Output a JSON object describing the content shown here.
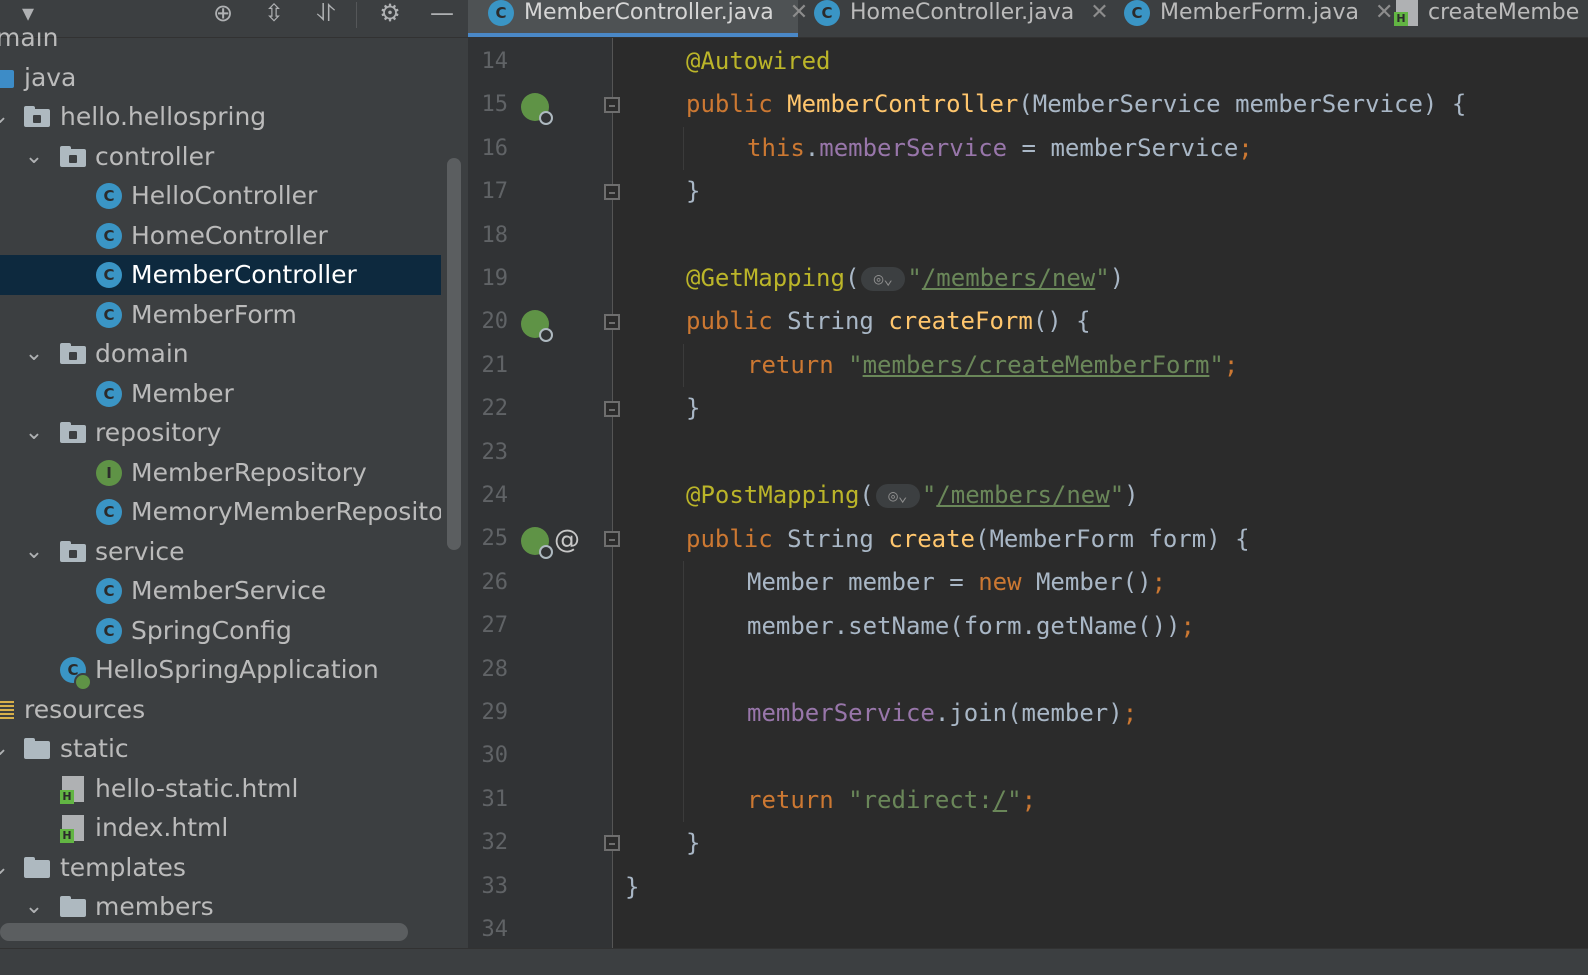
{
  "project_tree": {
    "items": [
      {
        "label": "main",
        "icon": "folder-icon",
        "row": -1
      },
      {
        "label": "java",
        "icon": "source-folder-icon"
      },
      {
        "label": "hello.hellospring",
        "icon": "package-icon"
      },
      {
        "label": "controller",
        "icon": "package-icon"
      },
      {
        "label": "HelloController",
        "icon": "class-icon"
      },
      {
        "label": "HomeController",
        "icon": "class-icon"
      },
      {
        "label": "MemberController",
        "icon": "class-icon"
      },
      {
        "label": "MemberForm",
        "icon": "class-icon"
      },
      {
        "label": "domain",
        "icon": "package-icon"
      },
      {
        "label": "Member",
        "icon": "class-icon"
      },
      {
        "label": "repository",
        "icon": "package-icon"
      },
      {
        "label": "MemberRepository",
        "icon": "interface-icon"
      },
      {
        "label": "MemoryMemberReposito",
        "icon": "class-icon"
      },
      {
        "label": "service",
        "icon": "package-icon"
      },
      {
        "label": "MemberService",
        "icon": "class-icon"
      },
      {
        "label": "SpringConfig",
        "icon": "class-icon"
      },
      {
        "label": "HelloSpringApplication",
        "icon": "spring-boot-app-icon"
      },
      {
        "label": "resources",
        "icon": "resources-folder-icon"
      },
      {
        "label": "static",
        "icon": "folder-icon"
      },
      {
        "label": "hello-static.html",
        "icon": "html-file-icon"
      },
      {
        "label": "index.html",
        "icon": "html-file-icon"
      },
      {
        "label": "templates",
        "icon": "folder-icon"
      },
      {
        "label": "members",
        "icon": "folder-icon"
      }
    ],
    "selected": "MemberController",
    "class_badge": "C",
    "interface_badge": "I"
  },
  "toolbar": {
    "icons": [
      "dropdown-arrow-icon",
      "locate-icon",
      "expand-all-icon",
      "collapse-all-icon",
      "gear-icon",
      "hide-icon"
    ]
  },
  "tabs": [
    {
      "label": "MemberController.java",
      "icon": "class-icon",
      "active": true
    },
    {
      "label": "HomeController.java",
      "icon": "class-icon"
    },
    {
      "label": "MemberForm.java",
      "icon": "class-icon"
    },
    {
      "label": "createMembe",
      "icon": "html-file-icon"
    }
  ],
  "editor": {
    "line_numbers": [
      "14",
      "15",
      "16",
      "17",
      "18",
      "19",
      "20",
      "21",
      "22",
      "23",
      "24",
      "25",
      "26",
      "27",
      "28",
      "29",
      "30",
      "31",
      "32",
      "33",
      "34"
    ],
    "gutter_at": "@",
    "tokens": {
      "l14_ann": "@Autowired",
      "l15_kw": "public ",
      "l15_fn": "MemberController",
      "l15_rest": "(MemberService memberService) {",
      "l16_kw": "this",
      "l16_dot": ".",
      "l16_fld": "memberService",
      "l16_rest": " = memberService",
      "l16_semi": ";",
      "l17": "}",
      "l19_ann": "@GetMapping",
      "l19_open": "(",
      "l19_q1": "\"",
      "l19_url": "/members/new",
      "l19_q2": "\"",
      "l19_close": ")",
      "l20_kw": "public ",
      "l20_type": "String ",
      "l20_fn": "createForm",
      "l20_rest": "() {",
      "l21_kw": "return ",
      "l21_q1": "\"",
      "l21_url": "members/createMemberForm",
      "l21_q2": "\"",
      "l21_semi": ";",
      "l22": "}",
      "l24_ann": "@PostMapping",
      "l24_open": "(",
      "l24_q1": "\"",
      "l24_url": "/members/new",
      "l24_q2": "\"",
      "l24_close": ")",
      "l25_kw": "public ",
      "l25_type": "String ",
      "l25_fn": "create",
      "l25_rest": "(MemberForm form) {",
      "l26_a": "Member member = ",
      "l26_kw": "new ",
      "l26_b": "Member()",
      "l26_semi": ";",
      "l27_a": "member.setName(form.getName())",
      "l27_semi": ";",
      "l29_fld": "memberService",
      "l29_rest": ".join(member)",
      "l29_semi": ";",
      "l31_kw": "return ",
      "l31_str": "\"redirect:",
      "l31_url": "/",
      "l31_q2": "\"",
      "l31_semi": ";",
      "l32": "}",
      "l33": "}",
      "globe_glyph": "◎⌄"
    }
  },
  "colors": {
    "keyword": "#cc7832",
    "annotation": "#bbb529",
    "method": "#ffc66d",
    "field": "#9876aa",
    "string": "#6a8759",
    "text": "#a9b7c6",
    "selection": "#0d293e",
    "accent": "#4a88c7"
  }
}
